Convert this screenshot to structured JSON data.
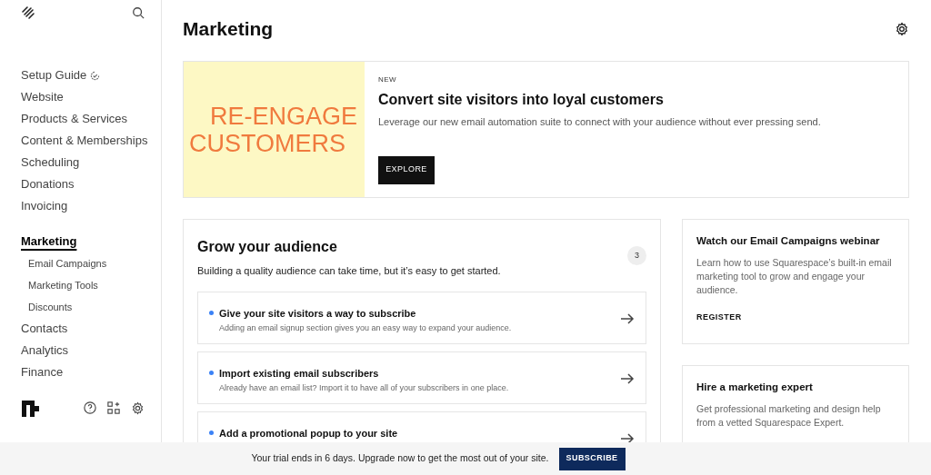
{
  "sidebar": {
    "items": [
      {
        "label": "Setup Guide",
        "selected": false,
        "badge_icon": true
      },
      {
        "label": "Website",
        "selected": false
      },
      {
        "label": "Products & Services",
        "selected": false
      },
      {
        "label": "Content & Memberships",
        "selected": false
      },
      {
        "label": "Scheduling",
        "selected": false
      },
      {
        "label": "Donations",
        "selected": false
      },
      {
        "label": "Invoicing",
        "selected": false
      },
      {
        "label": "Marketing",
        "selected": true,
        "children": [
          {
            "label": "Email Campaigns",
            "selected": false
          },
          {
            "label": "Marketing Tools",
            "selected": false
          },
          {
            "label": "Discounts",
            "selected": false
          }
        ]
      },
      {
        "label": "Contacts",
        "selected": false
      },
      {
        "label": "Analytics",
        "selected": false
      },
      {
        "label": "Finance",
        "selected": false
      }
    ]
  },
  "page": {
    "title": "Marketing"
  },
  "promo": {
    "image_lines": [
      "RE-ENGAGE",
      "CUSTOMERS"
    ],
    "eyebrow": "NEW",
    "title": "Convert site visitors into loyal customers",
    "text": "Leverage our new email automation suite to connect with your audience without ever pressing send.",
    "button": "EXPLORE"
  },
  "audience": {
    "title": "Grow your audience",
    "subtitle": "Building a quality audience can take time, but it’s easy to get started.",
    "count": "3",
    "tasks": [
      {
        "title": "Give your site visitors a way to subscribe",
        "text": "Adding an email signup section gives you an easy way to expand your audience."
      },
      {
        "title": "Import existing email subscribers",
        "text": "Already have an email list? Import it to have all of your subscribers in one place."
      },
      {
        "title": "Add a promotional popup to your site"
      }
    ]
  },
  "side_cards": [
    {
      "title": "Watch our Email Campaigns webinar",
      "text": "Learn how to use Squarespace’s built-in email marketing tool to grow and engage your audience.",
      "link": "REGISTER"
    },
    {
      "title": "Hire a marketing expert",
      "text": "Get professional marketing and design help from a vetted Squarespace Expert."
    }
  ],
  "trial_bar": {
    "text": "Your trial ends in 6 days. Upgrade now to get the most out of your site.",
    "button": "SUBSCRIBE"
  }
}
